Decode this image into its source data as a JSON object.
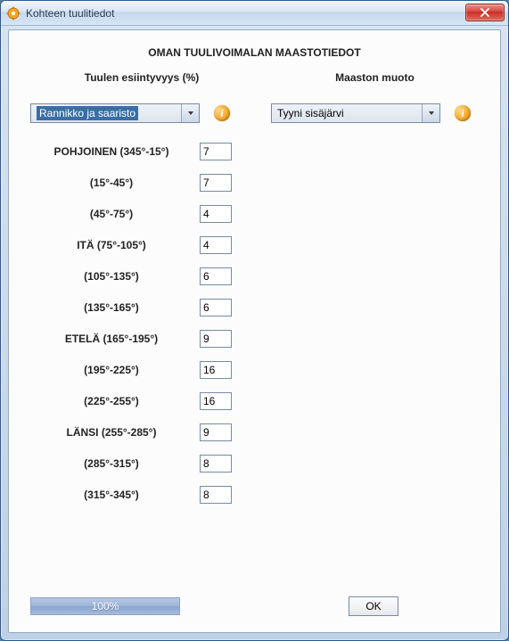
{
  "window": {
    "title": "Kohteen tuulitiedot"
  },
  "heading": "OMAN TUULIVOIMALAN MAASTOTIEDOT",
  "left": {
    "subhead": "Tuulen esiintyvyys (%)",
    "select": "Rannikko ja saaristo"
  },
  "right": {
    "subhead": "Maaston muoto",
    "select": "Tyyni sisäjärvi"
  },
  "rows": [
    {
      "label": "POHJOINEN (345°-15°)",
      "value": "7"
    },
    {
      "label": "(15°-45°)",
      "value": "7"
    },
    {
      "label": "(45°-75°)",
      "value": "4"
    },
    {
      "label": "ITÄ (75°-105°)",
      "value": "4"
    },
    {
      "label": "(105°-135°)",
      "value": "6"
    },
    {
      "label": "(135°-165°)",
      "value": "6"
    },
    {
      "label": "ETELÄ (165°-195°)",
      "value": "9"
    },
    {
      "label": "(195°-225°)",
      "value": "16"
    },
    {
      "label": "(225°-255°)",
      "value": "16"
    },
    {
      "label": "LÄNSI (255°-285°)",
      "value": "9"
    },
    {
      "label": "(285°-315°)",
      "value": "8"
    },
    {
      "label": "(315°-345°)",
      "value": "8"
    }
  ],
  "footer": {
    "progress": "100%",
    "ok": "OK"
  },
  "info_glyph": "i"
}
